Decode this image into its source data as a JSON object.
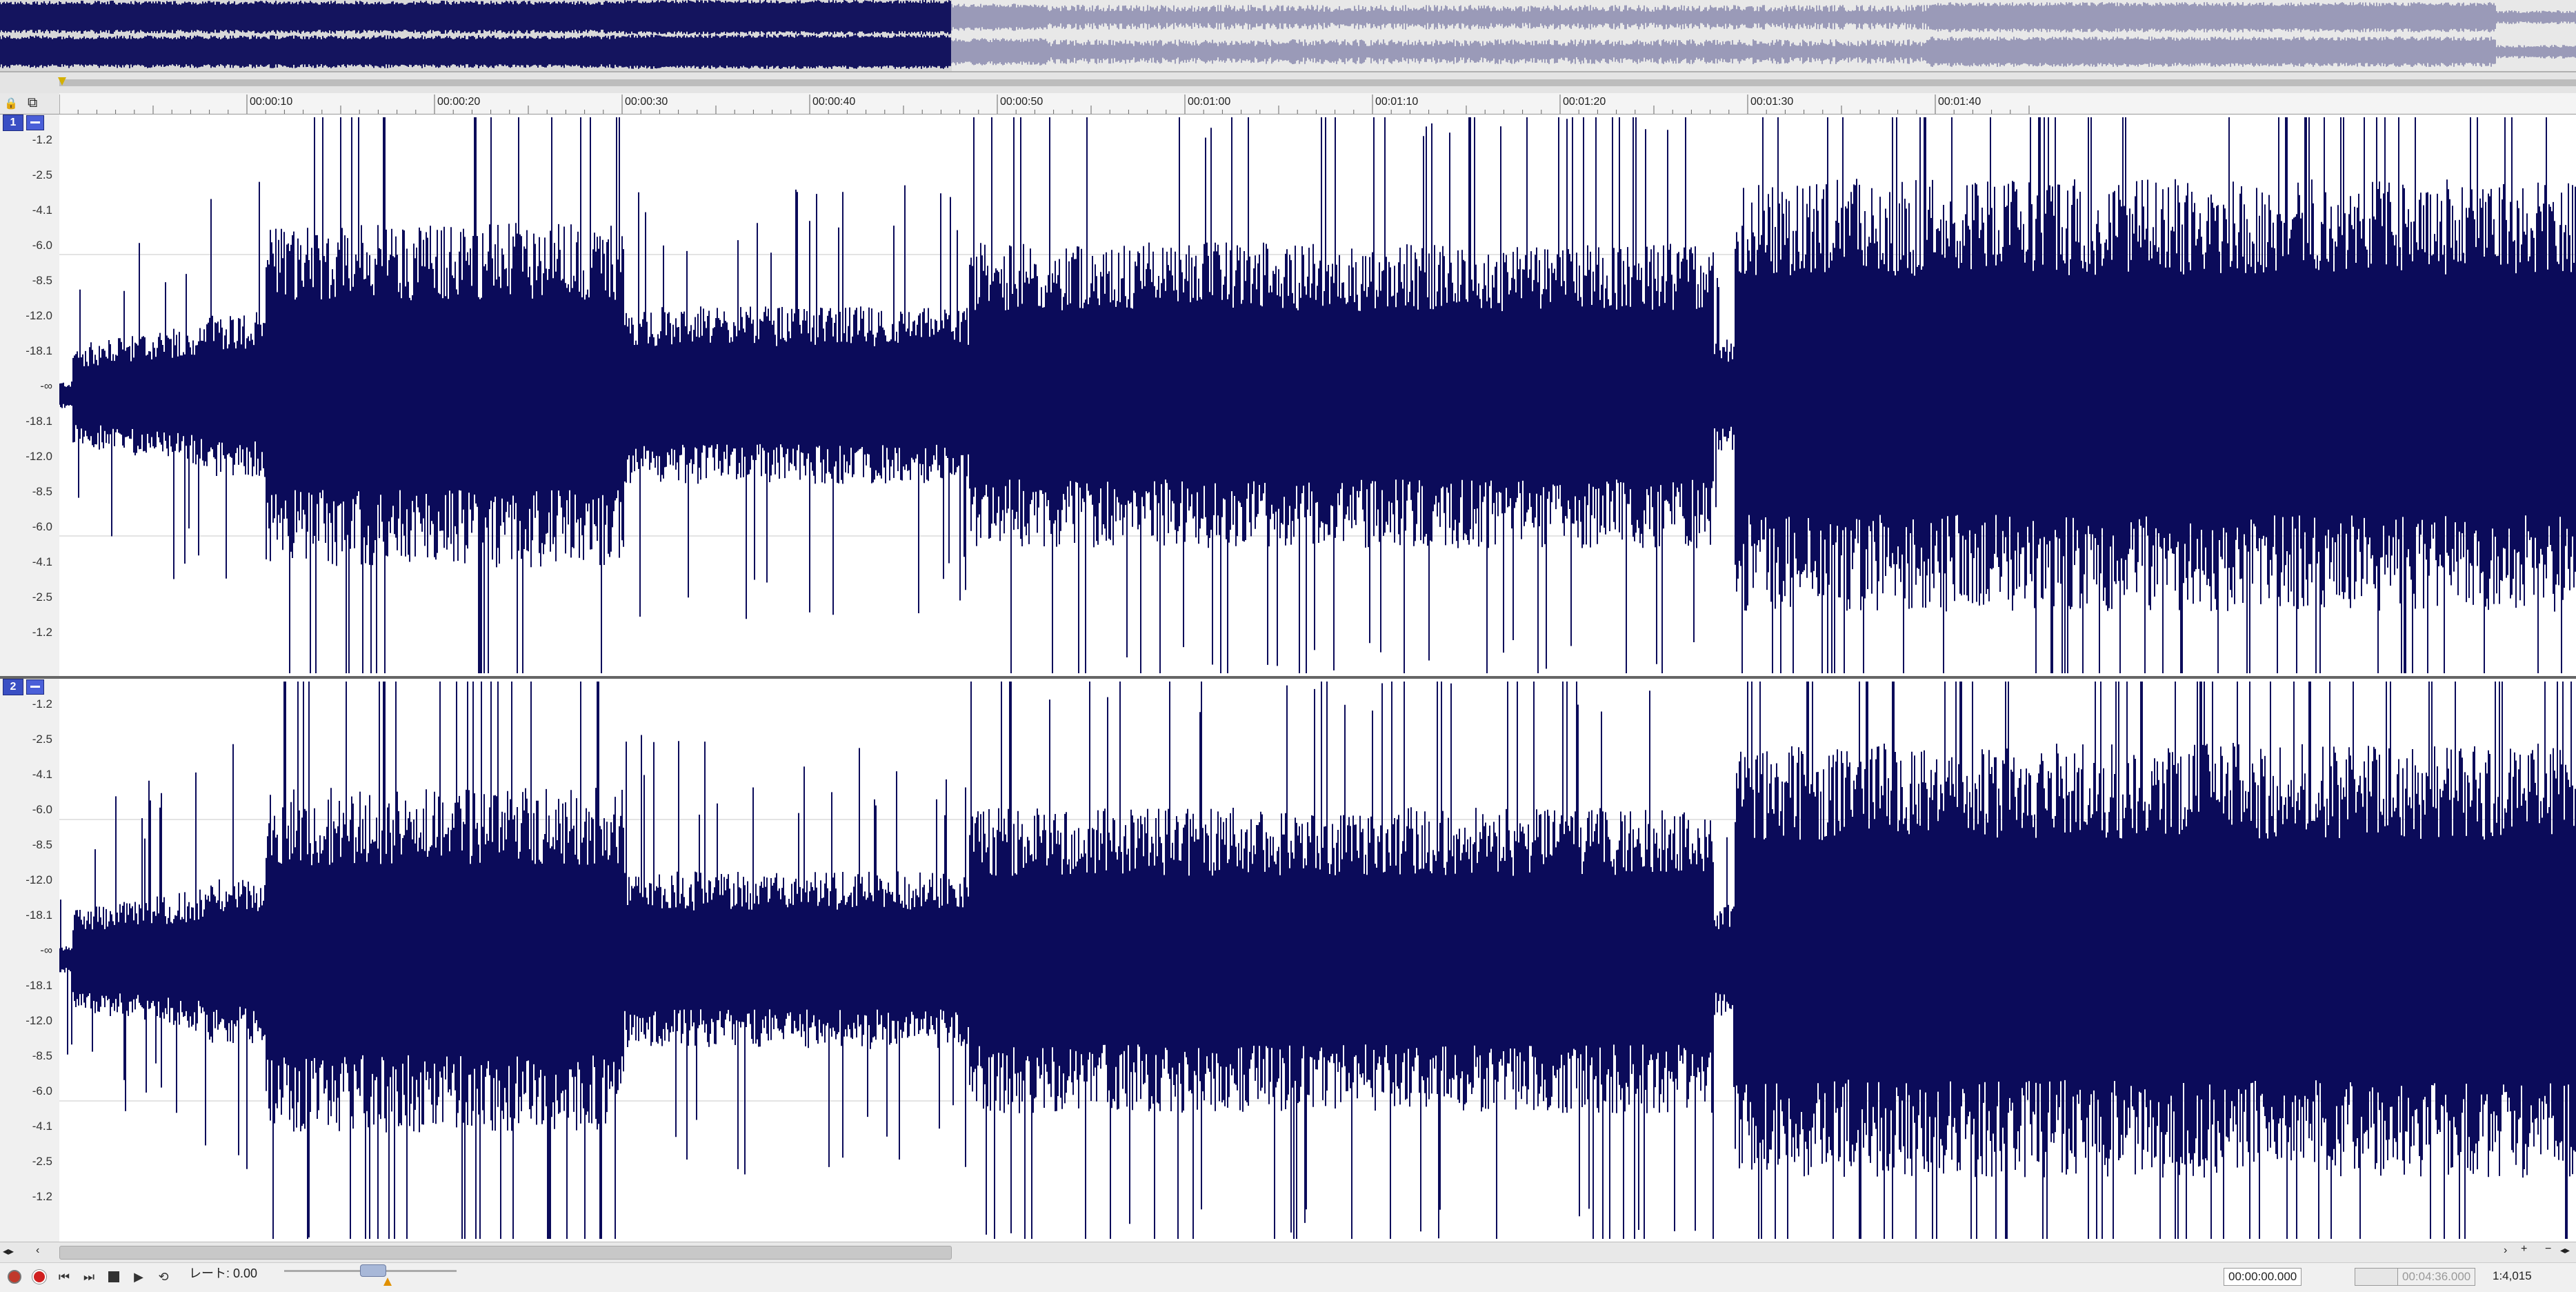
{
  "colors": {
    "waveform": "#0b0b5a",
    "overview_played": "#14145e",
    "overview_rest": "#9a9ab8",
    "background": "#f0f0f0"
  },
  "ruler": {
    "ticks": [
      "00:00:10",
      "00:00:20",
      "00:00:30",
      "00:00:40",
      "00:00:50",
      "00:01:00",
      "00:01:10",
      "00:01:20",
      "00:01:30",
      "00:01:40"
    ]
  },
  "channels": [
    {
      "number": "1",
      "db_labels": [
        "-1.2",
        "-2.5",
        "-4.1",
        "-6.0",
        "-8.5",
        "-12.0",
        "-18.1",
        "-∞",
        "-18.1",
        "-12.0",
        "-8.5",
        "-6.0",
        "-4.1",
        "-2.5",
        "-1.2"
      ]
    },
    {
      "number": "2",
      "db_labels": [
        "-1.2",
        "-2.5",
        "-4.1",
        "-6.0",
        "-8.5",
        "-12.0",
        "-18.1",
        "-∞",
        "-18.1",
        "-12.0",
        "-8.5",
        "-6.0",
        "-4.1",
        "-2.5",
        "-1.2"
      ]
    }
  ],
  "icons": {
    "lock": "lock-icon",
    "snap": "snap-icon",
    "zoom_in": "zoom-in-icon",
    "zoom_out": "zoom-out-icon"
  },
  "transport": {
    "rate_label": "レート: 0.00",
    "buttons": [
      "record-options",
      "record",
      "go-to-start",
      "go-to-end",
      "stop",
      "play",
      "loop"
    ]
  },
  "status": {
    "cursor_time": "00:00:00.000",
    "total_time": "00:04:36.000",
    "zoom": "1:4,015"
  }
}
